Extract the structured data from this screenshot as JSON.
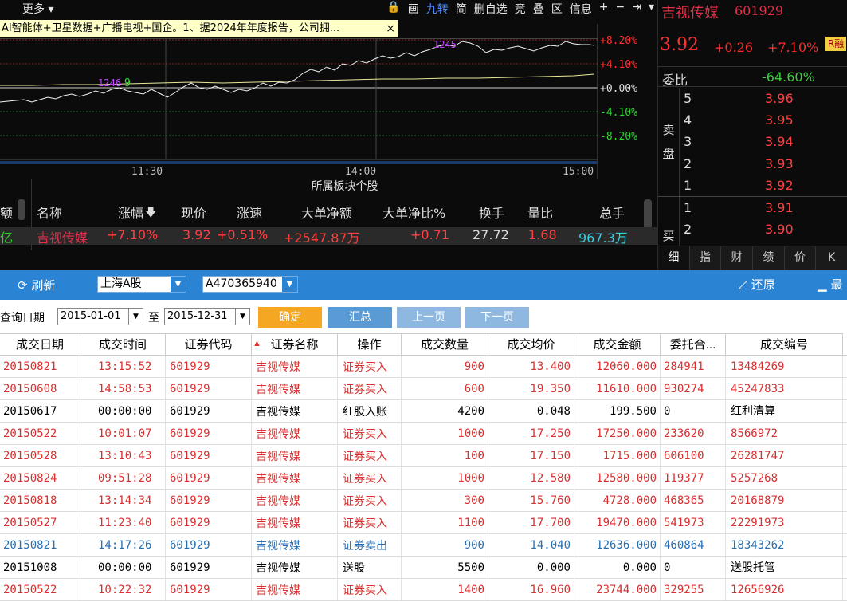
{
  "chart_toolbar": {
    "more_label": "更多",
    "tools": [
      "画",
      "九转",
      "简",
      "删自选",
      "竞",
      "叠",
      "区",
      "信息",
      "+",
      "−",
      "⇥",
      "▾"
    ]
  },
  "ticker": {
    "text": "AI智能体+卫星数据+广播电视+国企。1、据2024年年度报告，公司拥...",
    "close": "×"
  },
  "intraday": {
    "y_labels": [
      "+8.20%",
      "+4.10%",
      "+0.00%",
      "-4.10%",
      "-8.20%"
    ],
    "x_labels": [
      "11:30",
      "14:00",
      "15:00"
    ],
    "markers_left": "1246",
    "marker_left_num": "9",
    "markers_right": "1245"
  },
  "quote": {
    "name": "吉视传媒",
    "code": "601929",
    "price": "3.92",
    "change": "+0.26",
    "pct": "+7.10%",
    "badge": "R融",
    "weibi_label": "委比",
    "weibi_value": "-64.60%",
    "sell_label": "卖盘",
    "buy_label": "买",
    "sell": [
      {
        "lv": "5",
        "p": "3.96"
      },
      {
        "lv": "4",
        "p": "3.95"
      },
      {
        "lv": "3",
        "p": "3.94"
      },
      {
        "lv": "2",
        "p": "3.93"
      },
      {
        "lv": "1",
        "p": "3.92"
      }
    ],
    "buy": [
      {
        "lv": "1",
        "p": "3.91"
      },
      {
        "lv": "2",
        "p": "3.90"
      }
    ],
    "tabs": [
      "细",
      "指",
      "财",
      "绩",
      "价",
      "K"
    ]
  },
  "sector": {
    "title": "所属板块个股",
    "left_col_header": "额",
    "left_col_value": "亿",
    "headers": [
      "名称",
      "涨幅",
      "现价",
      "涨速",
      "大单净额",
      "大单净比%",
      "换手",
      "量比",
      "总手"
    ],
    "row": {
      "name": "吉视传媒",
      "pct": "+7.10%",
      "price": "3.92",
      "speed": "+0.51%",
      "net": "+2547.87万",
      "ratio": "+0.71",
      "turnover": "27.72",
      "vol_ratio": "1.68",
      "total": "967.3万"
    }
  },
  "toolbar": {
    "refresh": "刷新",
    "market": "上海A股",
    "account": "A470365940",
    "restore": "还原",
    "maximize": "最"
  },
  "query": {
    "label": "查询日期",
    "start": "2015-01-01",
    "to": "至",
    "end": "2015-12-31",
    "confirm": "确定",
    "summary": "汇总",
    "prev": "上一页",
    "next": "下一页"
  },
  "table": {
    "headers": [
      "成交日期",
      "成交时间",
      "证券代码",
      "▲",
      "证券名称",
      "操作",
      "成交数量",
      "成交均价",
      "成交金额",
      "委托合...",
      "成交编号"
    ],
    "rows": [
      {
        "d": "20150821",
        "t": "13:15:52",
        "c": "601929",
        "n": "吉视传媒",
        "op": "证券买入",
        "q": "900",
        "avg": "13.400",
        "amt": "12060.000",
        "w": "284941",
        "no": "13484269",
        "kind": "buy"
      },
      {
        "d": "20150608",
        "t": "14:58:53",
        "c": "601929",
        "n": "吉视传媒",
        "op": "证券买入",
        "q": "600",
        "avg": "19.350",
        "amt": "11610.000",
        "w": "930274",
        "no": "45247833",
        "kind": "buy"
      },
      {
        "d": "20150617",
        "t": "00:00:00",
        "c": "601929",
        "n": "吉视传媒",
        "op": "红股入账",
        "q": "4200",
        "avg": "0.048",
        "amt": "199.500",
        "w": "0",
        "no": "红利清算",
        "kind": "neutral"
      },
      {
        "d": "20150522",
        "t": "10:01:07",
        "c": "601929",
        "n": "吉视传媒",
        "op": "证券买入",
        "q": "1000",
        "avg": "17.250",
        "amt": "17250.000",
        "w": "233620",
        "no": "8566972",
        "kind": "buy"
      },
      {
        "d": "20150528",
        "t": "13:10:43",
        "c": "601929",
        "n": "吉视传媒",
        "op": "证券买入",
        "q": "100",
        "avg": "17.150",
        "amt": "1715.000",
        "w": "606100",
        "no": "26281747",
        "kind": "buy"
      },
      {
        "d": "20150824",
        "t": "09:51:28",
        "c": "601929",
        "n": "吉视传媒",
        "op": "证券买入",
        "q": "1000",
        "avg": "12.580",
        "amt": "12580.000",
        "w": "119377",
        "no": "5257268",
        "kind": "buy"
      },
      {
        "d": "20150818",
        "t": "13:14:34",
        "c": "601929",
        "n": "吉视传媒",
        "op": "证券买入",
        "q": "300",
        "avg": "15.760",
        "amt": "4728.000",
        "w": "468365",
        "no": "20168879",
        "kind": "buy"
      },
      {
        "d": "20150527",
        "t": "11:23:40",
        "c": "601929",
        "n": "吉视传媒",
        "op": "证券买入",
        "q": "1100",
        "avg": "17.700",
        "amt": "19470.000",
        "w": "541973",
        "no": "22291973",
        "kind": "buy"
      },
      {
        "d": "20150821",
        "t": "14:17:26",
        "c": "601929",
        "n": "吉视传媒",
        "op": "证券卖出",
        "q": "900",
        "avg": "14.040",
        "amt": "12636.000",
        "w": "460864",
        "no": "18343262",
        "kind": "sell"
      },
      {
        "d": "20151008",
        "t": "00:00:00",
        "c": "601929",
        "n": "吉视传媒",
        "op": "送股",
        "q": "5500",
        "avg": "0.000",
        "amt": "0.000",
        "w": "0",
        "no": "送股托管",
        "kind": "neutral"
      },
      {
        "d": "20150522",
        "t": "10:22:32",
        "c": "601929",
        "n": "吉视传媒",
        "op": "证券买入",
        "q": "1400",
        "avg": "16.960",
        "amt": "23744.000",
        "w": "329255",
        "no": "12656926",
        "kind": "buy"
      }
    ]
  },
  "colors": {
    "buy": "#d83030",
    "sell": "#2a6fb0",
    "neutral": "#000000",
    "toolbar": "#2a84d3",
    "confirm": "#f5a623",
    "button": "#5b9bd5"
  }
}
